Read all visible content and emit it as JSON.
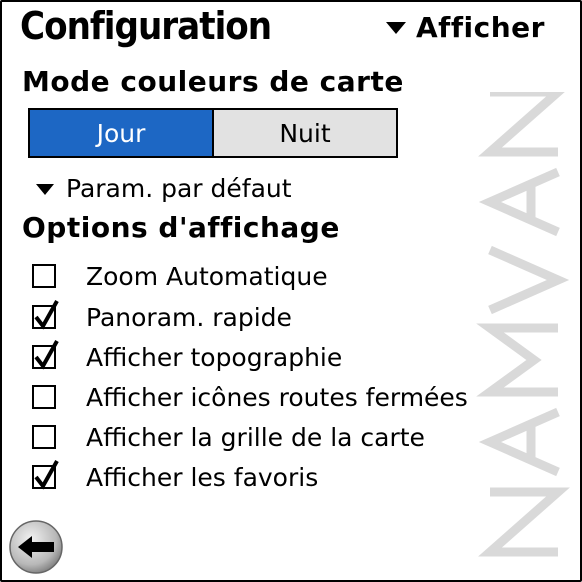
{
  "header": {
    "title": "Configuration",
    "menu_label": "Afficher"
  },
  "map_mode": {
    "label": "Mode couleurs de carte",
    "options": [
      "Jour",
      "Nuit"
    ],
    "selected": "Jour"
  },
  "defaults_label": "Param. par défaut",
  "display_options": {
    "label": "Options d'affichage",
    "items": [
      {
        "label": "Zoom Automatique",
        "checked": false
      },
      {
        "label": "Panoram. rapide",
        "checked": true
      },
      {
        "label": "Afficher topographie",
        "checked": true
      },
      {
        "label": "Afficher icônes routes fermées",
        "checked": false
      },
      {
        "label": "Afficher la grille de la carte",
        "checked": false
      },
      {
        "label": "Afficher les favoris",
        "checked": true
      }
    ]
  },
  "brand_watermark": "NAVMAN",
  "icons": {
    "back": "back-arrow-icon",
    "dropdown": "triangle-down-icon"
  },
  "colors": {
    "selected_segment": "#1d67c4",
    "unselected_segment": "#e2e2e2",
    "watermark": "#d6d6d6"
  }
}
